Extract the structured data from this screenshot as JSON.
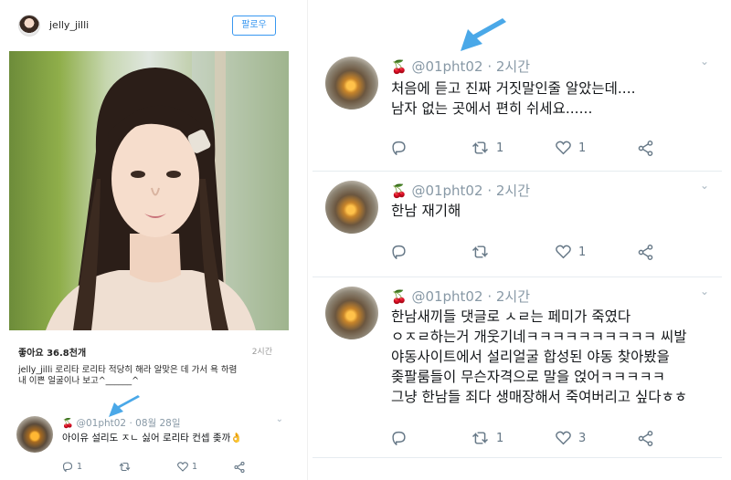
{
  "instagram": {
    "username": "jelly_jilli",
    "follow_label": "팔로우",
    "likes": "좋아요 36.8천개",
    "time": "2시간",
    "caption_lines": [
      "jelly_jilli 로리타 로리타 적당히 해라 알맞은 데 가서 욕 하렴",
      "내 이쁜 얼굴이나 보고^______^"
    ]
  },
  "mini_tweet": {
    "handle": "@01pht02",
    "date": "· 08월 28일",
    "text": "아이유 설리도 ㅈㄴ 싫어 로리타 컨셉 좆까",
    "emoji": "👌",
    "reply_count": "1",
    "retweet_count": "",
    "like_count": "1"
  },
  "tweets": [
    {
      "handle": "@01pht02",
      "time": "· 2시간",
      "lines": [
        "처음에 듣고 진짜 거짓말인줄 알았는데....",
        "남자 없는 곳에서 편히 쉬세요......"
      ],
      "reply_count": "",
      "retweet_count": "1",
      "like_count": "1"
    },
    {
      "handle": "@01pht02",
      "time": "· 2시간",
      "lines": [
        "한남 재기해"
      ],
      "reply_count": "",
      "retweet_count": "",
      "like_count": "1"
    },
    {
      "handle": "@01pht02",
      "time": "· 2시간",
      "lines": [
        "한남새끼들 댓글로 ㅅㄹ는 페미가 죽였다",
        "ㅇㅈㄹ하는거 개웃기네ㅋㅋㅋㅋㅋㅋㅋㅋㅋㅋ 씨발",
        "야동사이트에서 설리얼굴 합성된 야동 찾아봤을",
        "좆팔룸들이 무슨자격으로 말을 얹어ㅋㅋㅋㅋㅋ",
        "그냥 한남들 죄다 생매장해서 죽여버리고 싶다ㅎㅎ"
      ],
      "reply_count": "",
      "retweet_count": "1",
      "like_count": "3"
    }
  ],
  "colors": {
    "handle_gray": "#8899a6",
    "action_gray": "#657786",
    "follow_blue": "#3897f0",
    "arrow_blue": "#4aa8e8",
    "cherry_red": "#c0162c"
  },
  "icons": {
    "reply": "reply-icon",
    "retweet": "retweet-icon",
    "like": "heart-icon",
    "share": "share-icon",
    "more": "chevron-down-icon",
    "cherry": "cherry-icon"
  }
}
